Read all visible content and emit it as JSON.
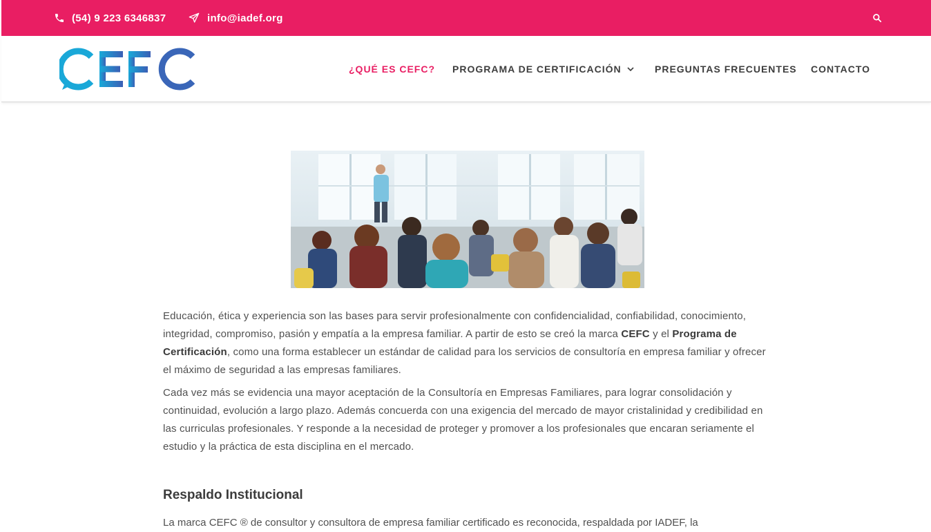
{
  "topbar": {
    "phone": "(54) 9 223 6346837",
    "email": "info@iadef.org",
    "icons": {
      "phone": "phone-icon",
      "email": "paper-plane-icon",
      "search": "search-icon"
    },
    "color": "#e91e63"
  },
  "header": {
    "logo_text": "CEFC",
    "logo_colors": [
      "#1aa8d8",
      "#3a66b8"
    ],
    "nav": [
      {
        "label": "¿QUÉ ES CEFC?",
        "active": true
      },
      {
        "label": "PROGRAMA DE CERTIFICACIÓN",
        "dropdown": true
      },
      {
        "label": "PREGUNTAS FRECUENTES"
      },
      {
        "label": "CONTACTO"
      }
    ]
  },
  "content": {
    "p1": {
      "a": "Educación, ética y experiencia son las bases para servir profesionalmente con confidencialidad, confiabilidad, conocimiento, integridad, compromiso, pasión y empatía a la empresa familiar. A partir de esto se creó la marca ",
      "b": "CEFC",
      "c": " y el ",
      "d": "Programa de Certificación",
      "e": ", como una forma establecer un estándar de calidad para los servicios de consultoría en empresa familiar y ofrecer el máximo de seguridad a las empresas familiares."
    },
    "p2": "Cada vez más se evidencia una mayor aceptación de la Consultoría en Empresas Familiares, para lograr consolidación y continuidad, evolución a largo plazo. Además concuerda con una exigencia del mercado de mayor cristalinidad y credibilidad en las curriculas profesionales. Y responde a la necesidad de proteger y promover a los profesionales que encaran seriamente el estudio y la práctica de esta disciplina en el mercado.",
    "section_title": "Respaldo Institucional",
    "p3": "La marca CEFC ® de consultor y consultora de empresa familiar certificado es reconocida, respaldada por IADEF, la"
  }
}
